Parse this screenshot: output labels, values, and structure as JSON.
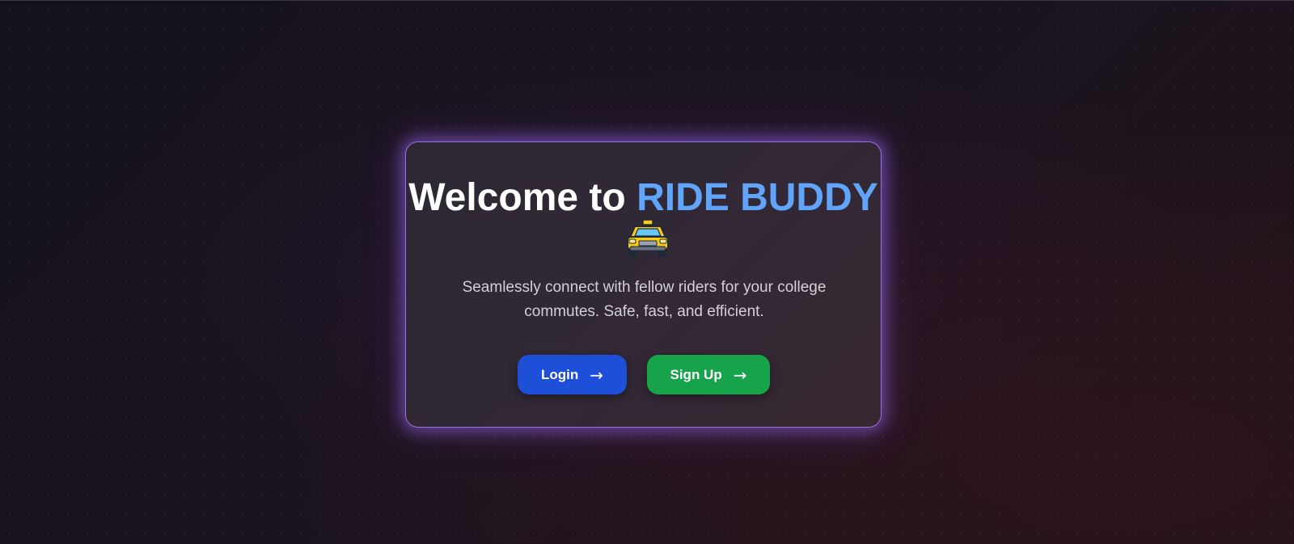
{
  "hero": {
    "title_prefix": "Welcome to ",
    "title_brand": "RIDE BUDDY",
    "title_icon": "taxi-icon",
    "subtitle": "Seamlessly connect with fellow riders for your college commutes. Safe, fast, and efficient."
  },
  "actions": {
    "login_label": "Login",
    "signup_label": "Sign Up",
    "arrow": "→"
  },
  "colors": {
    "brand_accent": "#60a5fa",
    "login": "#1d4fd8",
    "signup": "#16a34a",
    "card_border": "#9b6fe0"
  }
}
